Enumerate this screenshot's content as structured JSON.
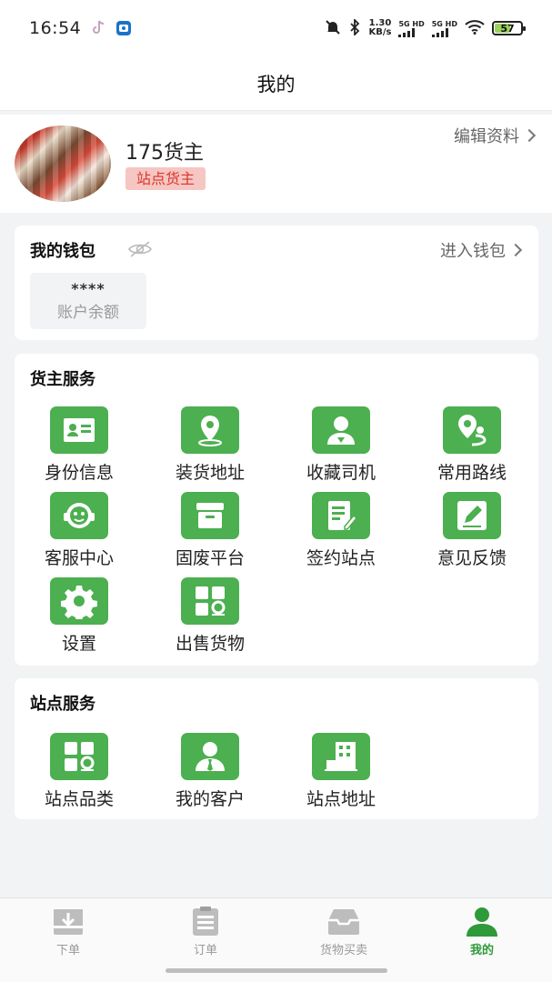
{
  "status_bar": {
    "time": "16:54",
    "net_speed_value": "1.30",
    "net_speed_unit": "KB/s",
    "sig1": "5G HD",
    "sig2": "5G HD",
    "battery": "57"
  },
  "header": {
    "title": "我的"
  },
  "profile": {
    "name": "175货主",
    "role": "站点货主",
    "edit_label": "编辑资料"
  },
  "wallet": {
    "title": "我的钱包",
    "enter_label": "进入钱包",
    "balance_value": "****",
    "balance_label": "账户余额"
  },
  "shipper_services": {
    "title": "货主服务",
    "items": [
      {
        "label": "身份信息",
        "icon": "id-card-icon"
      },
      {
        "label": "装货地址",
        "icon": "location-pin-icon"
      },
      {
        "label": "收藏司机",
        "icon": "driver-person-icon"
      },
      {
        "label": "常用路线",
        "icon": "route-icon"
      },
      {
        "label": "客服中心",
        "icon": "customer-service-icon"
      },
      {
        "label": "固废平台",
        "icon": "archive-box-icon"
      },
      {
        "label": "签约站点",
        "icon": "contract-edit-icon"
      },
      {
        "label": "意见反馈",
        "icon": "pencil-feedback-icon"
      },
      {
        "label": "设置",
        "icon": "gear-icon"
      },
      {
        "label": "出售货物",
        "icon": "goods-grid-icon"
      }
    ]
  },
  "station_services": {
    "title": "站点服务",
    "items": [
      {
        "label": "站点品类",
        "icon": "category-grid-icon"
      },
      {
        "label": "我的客户",
        "icon": "client-person-icon"
      },
      {
        "label": "站点地址",
        "icon": "building-icon"
      }
    ]
  },
  "tabbar": {
    "tabs": [
      {
        "label": "下单",
        "icon": "download-box-icon",
        "active": false
      },
      {
        "label": "订单",
        "icon": "clipboard-list-icon",
        "active": false
      },
      {
        "label": "货物买卖",
        "icon": "tray-icon",
        "active": false
      },
      {
        "label": "我的",
        "icon": "user-icon",
        "active": true
      }
    ]
  },
  "colors": {
    "accent_green": "#4caf50",
    "active_tab_green": "#2e9a3a",
    "badge_bg": "#f6c6c2",
    "badge_text": "#d9362c"
  }
}
